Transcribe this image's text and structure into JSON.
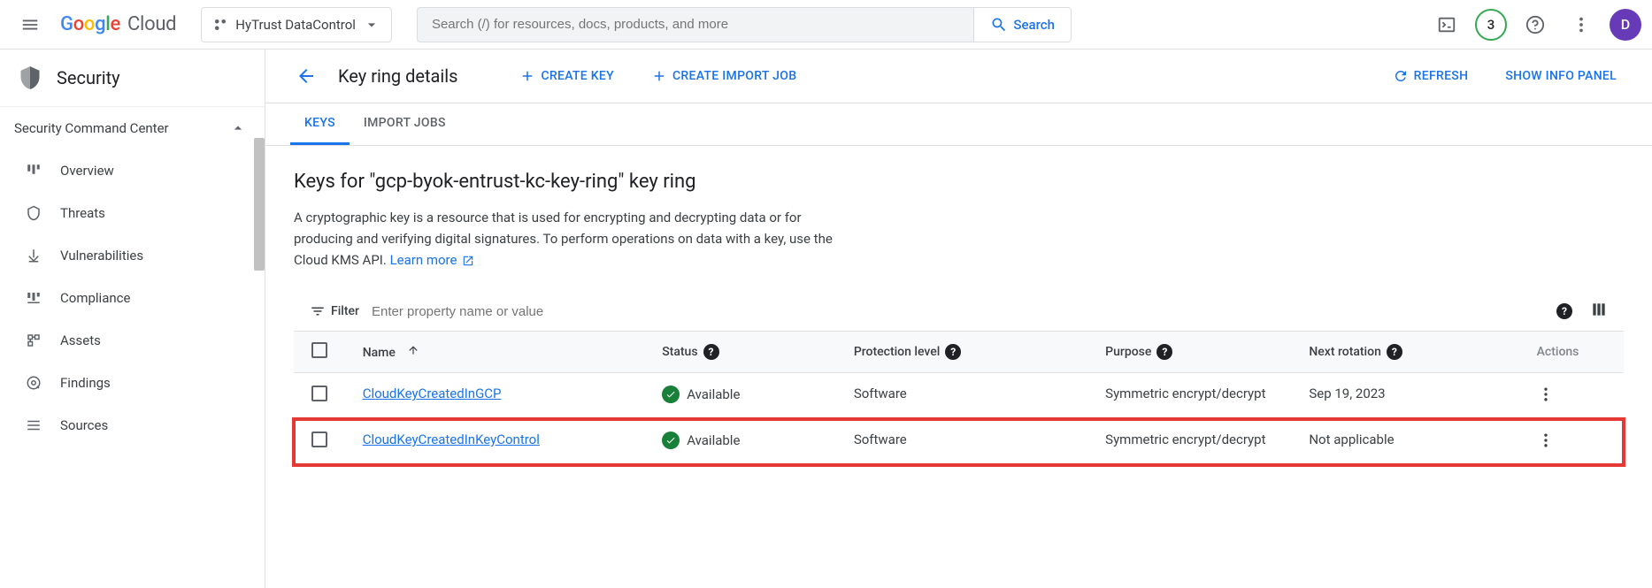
{
  "header": {
    "logo_cloud": "Cloud",
    "project": "HyTrust DataControl",
    "search_placeholder": "Search (/) for resources, docs, products, and more",
    "search_button": "Search",
    "badge_count": "3",
    "avatar_letter": "D"
  },
  "sidebar": {
    "title": "Security",
    "section": "Security Command Center",
    "items": [
      {
        "label": "Overview"
      },
      {
        "label": "Threats"
      },
      {
        "label": "Vulnerabilities"
      },
      {
        "label": "Compliance"
      },
      {
        "label": "Assets"
      },
      {
        "label": "Findings"
      },
      {
        "label": "Sources"
      }
    ]
  },
  "content": {
    "page_title": "Key ring details",
    "actions": {
      "create_key": "CREATE KEY",
      "create_import_job": "CREATE IMPORT JOB",
      "refresh": "REFRESH",
      "show_info": "SHOW INFO PANEL"
    },
    "tabs": [
      {
        "label": "KEYS",
        "active": true
      },
      {
        "label": "IMPORT JOBS",
        "active": false
      }
    ],
    "heading": "Keys for \"gcp-byok-entrust-kc-key-ring\" key ring",
    "description": "A cryptographic key is a resource that is used for encrypting and decrypting data or for producing and verifying digital signatures. To perform operations on data with a key, use the Cloud KMS API. ",
    "learn_more": "Learn more",
    "filter": {
      "label": "Filter",
      "placeholder": "Enter property name or value"
    },
    "columns": {
      "name": "Name",
      "status": "Status",
      "protection": "Protection level",
      "purpose": "Purpose",
      "rotation": "Next rotation",
      "actions": "Actions"
    },
    "rows": [
      {
        "name": "CloudKeyCreatedInGCP",
        "status": "Available",
        "protection": "Software",
        "purpose": "Symmetric encrypt/decrypt",
        "rotation": "Sep 19, 2023",
        "highlight": false
      },
      {
        "name": "CloudKeyCreatedInKeyControl",
        "status": "Available",
        "protection": "Software",
        "purpose": "Symmetric encrypt/decrypt",
        "rotation": "Not applicable",
        "highlight": true
      }
    ]
  }
}
